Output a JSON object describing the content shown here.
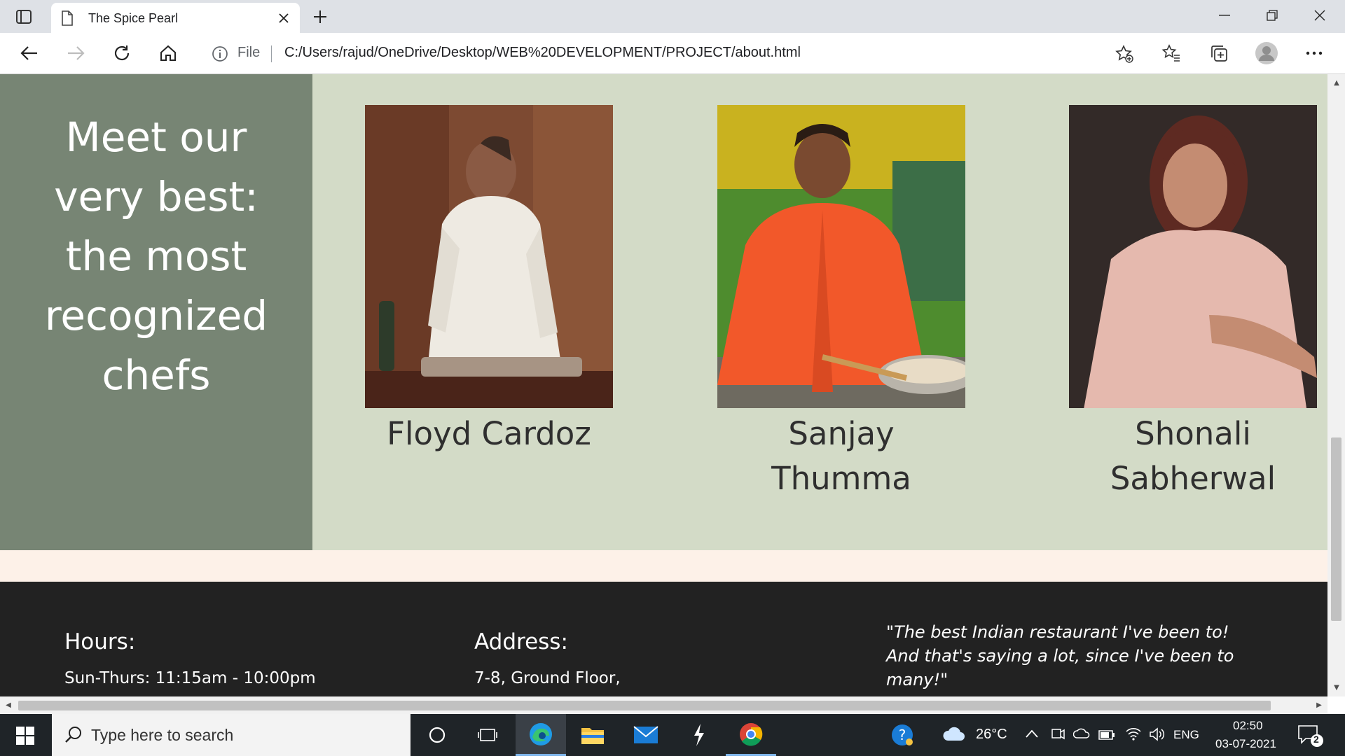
{
  "browser": {
    "tab_title": "The Spice Pearl",
    "omnibox_scheme": "File",
    "url": "C:/Users/rajud/OneDrive/Desktop/WEB%20DEVELOPMENT/PROJECT/about.html"
  },
  "page": {
    "heading": "Meet our very best: the most recognized chefs",
    "chefs": [
      {
        "name": "Floyd Cardoz",
        "photo": "chef-in-white-coat-photo"
      },
      {
        "name": "Sanjay Thumma",
        "photo": "chef-in-orange-coat-photo"
      },
      {
        "name": "Shonali Sabherwal",
        "photo": "woman-in-pink-dress-photo"
      }
    ],
    "footer": {
      "hours_heading": "Hours:",
      "hours_line": "Sun-Thurs: 11:15am - 10:00pm",
      "address_heading": "Address:",
      "address_line": "7-8, Ground Floor,",
      "quote": "\"The best Indian restaurant I've been to! And that's saying a lot, since I've been to many!\""
    },
    "colors": {
      "section_bg": "#d3dbc7",
      "heading_panel_bg": "#778574",
      "footer_bg": "#222222",
      "page_bg": "#fdf1e8"
    }
  },
  "taskbar": {
    "search_placeholder": "Type here to search",
    "temperature": "26°C",
    "language": "ENG",
    "time": "02:50",
    "date": "03-07-2021",
    "notification_count": "2"
  }
}
